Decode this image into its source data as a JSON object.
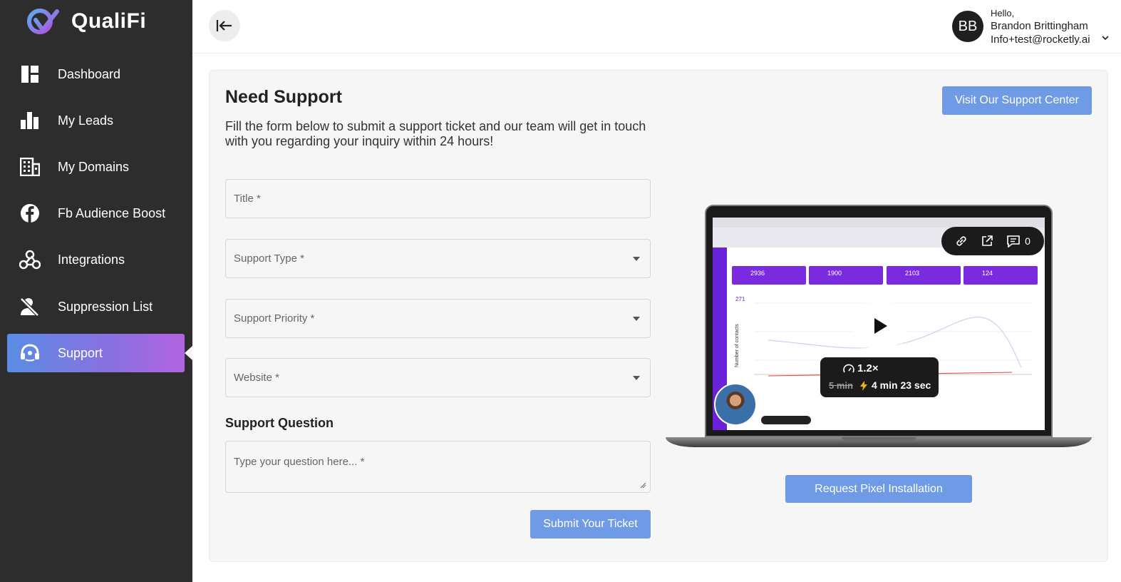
{
  "brand": {
    "name": "QualiFi"
  },
  "sidebar": {
    "items": [
      {
        "label": "Dashboard",
        "icon": "dashboard-icon"
      },
      {
        "label": "My Leads",
        "icon": "bar-chart-icon"
      },
      {
        "label": "My Domains",
        "icon": "building-icon"
      },
      {
        "label": "Fb Audience Boost",
        "icon": "facebook-icon"
      },
      {
        "label": "Integrations",
        "icon": "webhook-icon"
      },
      {
        "label": "Suppression List",
        "icon": "user-block-icon"
      },
      {
        "label": "Support",
        "icon": "headset-icon",
        "active": true
      }
    ]
  },
  "header": {
    "avatar_initials": "BB",
    "greeting": "Hello,",
    "user_name": "Brandon Brittingham",
    "user_email": "Info+test@rocketly.ai"
  },
  "support": {
    "title": "Need Support",
    "description": "Fill the form below to submit a support ticket and our team will get in touch with you regarding your inquiry within 24 hours!",
    "visit_button": "Visit Our Support Center",
    "fields": {
      "title_placeholder": "Title *",
      "type_placeholder": "Support Type *",
      "priority_placeholder": "Support Priority *",
      "website_placeholder": "Website *"
    },
    "question_label": "Support Question",
    "question_placeholder": "Type your question here... *",
    "submit_button": "Submit Your Ticket",
    "pixel_button": "Request Pixel Installation"
  },
  "video": {
    "comment_count": "0",
    "speed": "1.2×",
    "original_time": "5 min",
    "new_time": "4 min 23 sec",
    "stats": [
      "2936",
      "1900",
      "2103",
      "124"
    ],
    "leads_label": "271"
  },
  "colors": {
    "sidebar_bg": "#2d2d2d",
    "accent": "#6f9be6",
    "active_gradient_start": "#5b8de4",
    "active_gradient_end": "#b364e0"
  }
}
